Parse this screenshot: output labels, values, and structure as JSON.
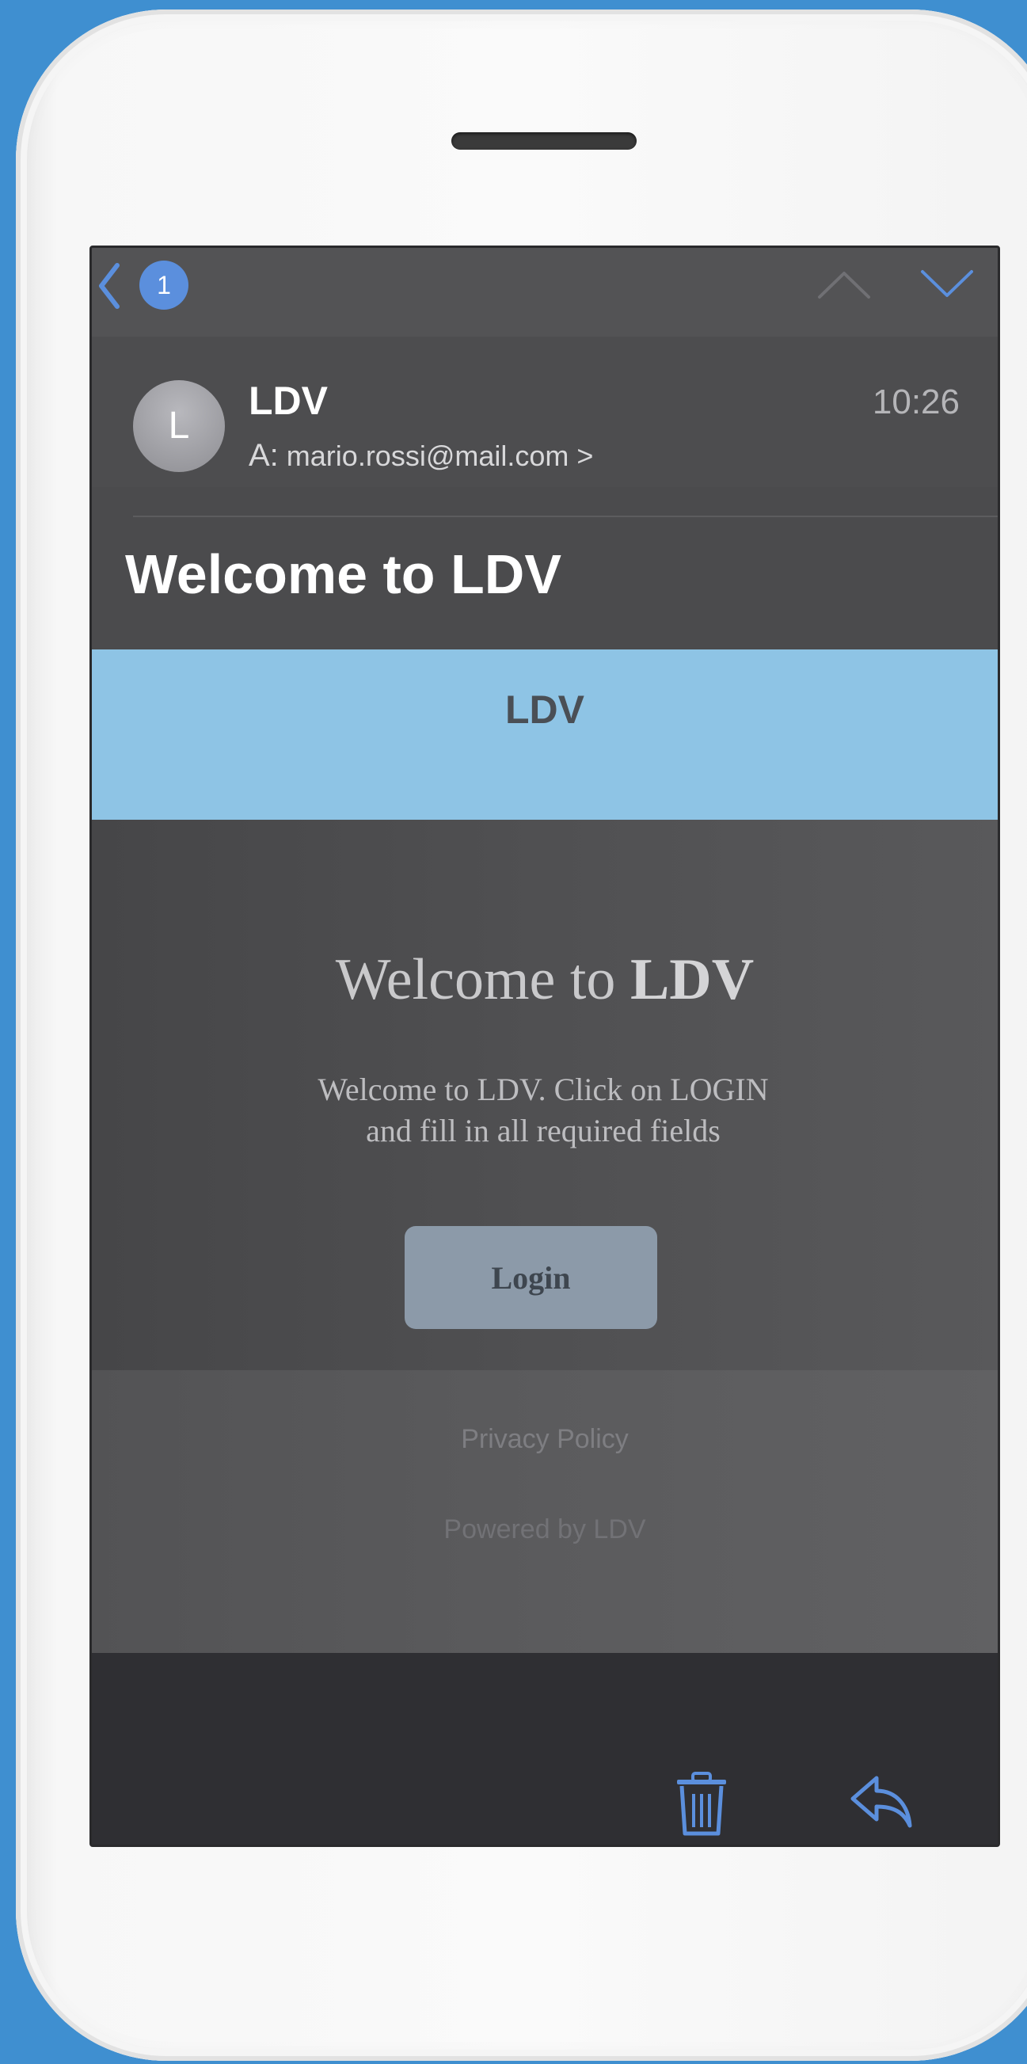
{
  "nav": {
    "badge_count": "1"
  },
  "email": {
    "avatar_initial": "L",
    "sender": "LDV",
    "time": "10:26",
    "to_prefix": "A:",
    "to_address": "mario.rossi@mail.com >",
    "subject": "Welcome to LDV"
  },
  "body": {
    "banner_title": "LDV",
    "welcome_prefix": "Welcome to",
    "welcome_brand": "LDV",
    "message_line1": "Welcome to LDV. Click on LOGIN",
    "message_line2": "and fill in all required fields",
    "login_label": "Login"
  },
  "footer": {
    "privacy_policy": "Privacy Policy",
    "powered_by": "Powered by LDV"
  },
  "colors": {
    "background": "#3f8fd0",
    "accent": "#5b8fdd",
    "banner": "#8ec4e5",
    "button": "#8c9aa9"
  }
}
